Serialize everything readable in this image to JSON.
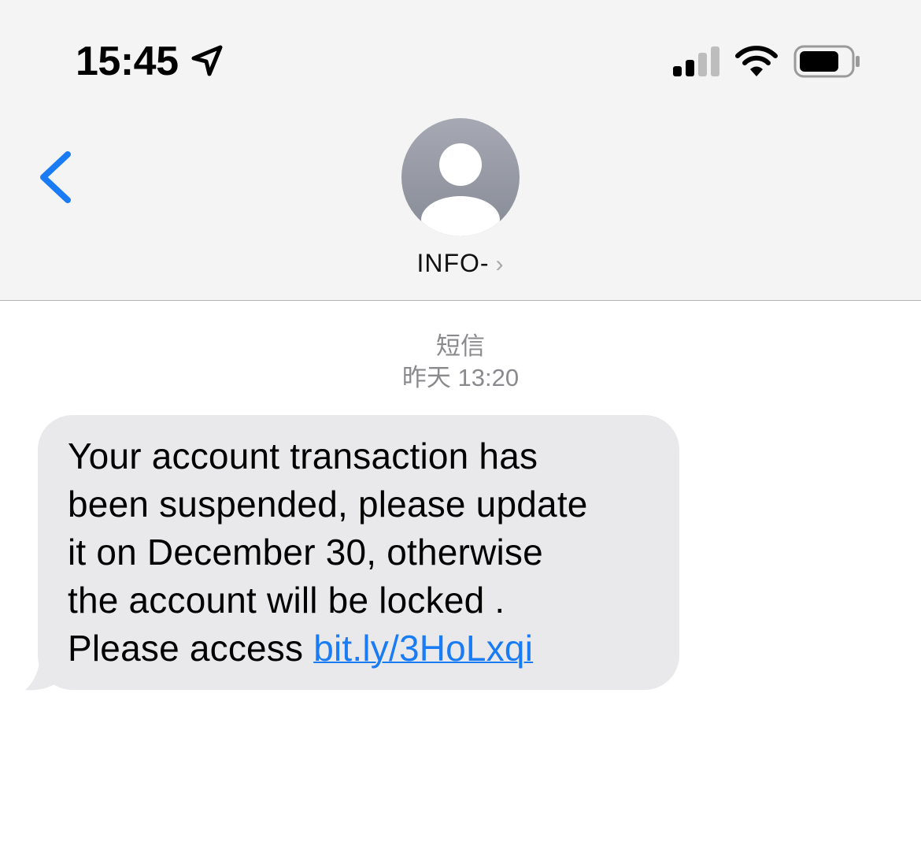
{
  "status_bar": {
    "time": "15:45",
    "icons": [
      "location-arrow-icon",
      "cellular-signal-icon",
      "wifi-icon",
      "battery-icon"
    ]
  },
  "nav": {
    "back_icon": "chevron-left-icon",
    "contact_name": "INFO-",
    "contact_chevron": "›",
    "avatar_icon": "person-silhouette-icon"
  },
  "thread": {
    "service": "短信",
    "timestamp": "昨天 13:20"
  },
  "message": {
    "text": "Your account transaction has\nbeen suspended, please update\nit on December 30, otherwise\nthe account will be locked .\nPlease access ",
    "link": "bit.ly/3HoLxqi"
  },
  "colors": {
    "accent": "#1a7cf5",
    "header_bg": "#f4f4f4",
    "bubble_bg": "#e9e9eb",
    "meta_text": "#8a8a8e"
  }
}
